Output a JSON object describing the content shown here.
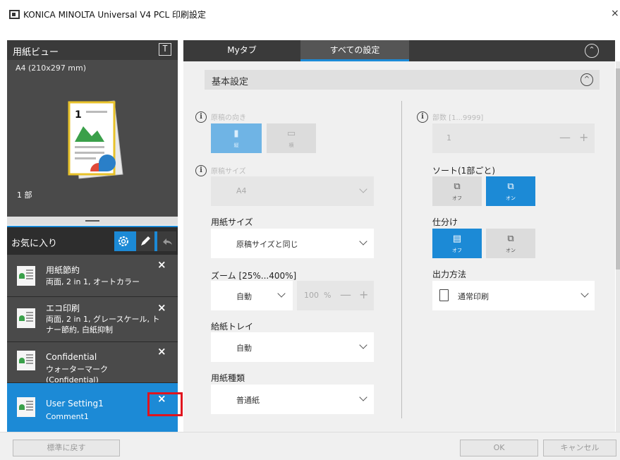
{
  "window": {
    "title": "KONICA MINOLTA Universal V4 PCL 印刷設定",
    "close_glyph": "×"
  },
  "preview": {
    "title": "用紙ビュー",
    "toggle_glyph": "T",
    "paper_size": "A4 (210x297 mm)",
    "copies": "1 部"
  },
  "favorites": {
    "title": "お気に入り",
    "items": [
      {
        "name": "用紙節約",
        "desc": "両面, 2 in 1, オートカラー",
        "close": "×",
        "selected": false
      },
      {
        "name": "エコ印刷",
        "desc": "両面, 2 in 1, グレースケール, トナー節約, 白紙抑制",
        "close": "×",
        "selected": false
      },
      {
        "name": "Confidential",
        "desc": "ウォーターマーク (Confidential)",
        "close": "×",
        "selected": false
      },
      {
        "name": "User Setting1",
        "desc": "Comment1",
        "close": "×",
        "selected": true
      }
    ]
  },
  "tabs": [
    {
      "label": "Myタブ",
      "active": false
    },
    {
      "label": "すべての設定",
      "active": true
    }
  ],
  "section": {
    "title": "基本設定",
    "collapse_glyph": "^"
  },
  "left_col": {
    "orientation": {
      "label": "原稿の向き",
      "options": [
        "縦",
        "横"
      ]
    },
    "orig_size": {
      "label": "原稿サイズ",
      "value": "A4"
    },
    "paper_size": {
      "label": "用紙サイズ",
      "value": "原稿サイズと同じ"
    },
    "zoom": {
      "label": "ズーム [25%...400%]",
      "value": "自動",
      "percent": "100",
      "unit": "%",
      "minus": "—",
      "plus": "+"
    },
    "tray": {
      "label": "給紙トレイ",
      "value": "自動"
    },
    "paper_type": {
      "label": "用紙種類",
      "value": "普通紙"
    }
  },
  "right_col": {
    "copies": {
      "label": "部数 [1...9999]",
      "value": "1",
      "minus": "—",
      "plus": "+"
    },
    "sort": {
      "label": "ソート(1部ごと)",
      "options": [
        "オフ",
        "オン"
      ],
      "selected": "オン"
    },
    "offset": {
      "label": "仕分け",
      "options": [
        "オフ",
        "オン"
      ],
      "selected": "オフ"
    },
    "output": {
      "label": "出力方法",
      "value": "通常印刷"
    }
  },
  "info_glyph": "i",
  "footer": {
    "reset_label": "標準に戻す",
    "ok_label": "OK",
    "cancel_label": "キャンセル"
  },
  "colors": {
    "accent": "#1c8ad6",
    "highlight": "#e0141e"
  }
}
